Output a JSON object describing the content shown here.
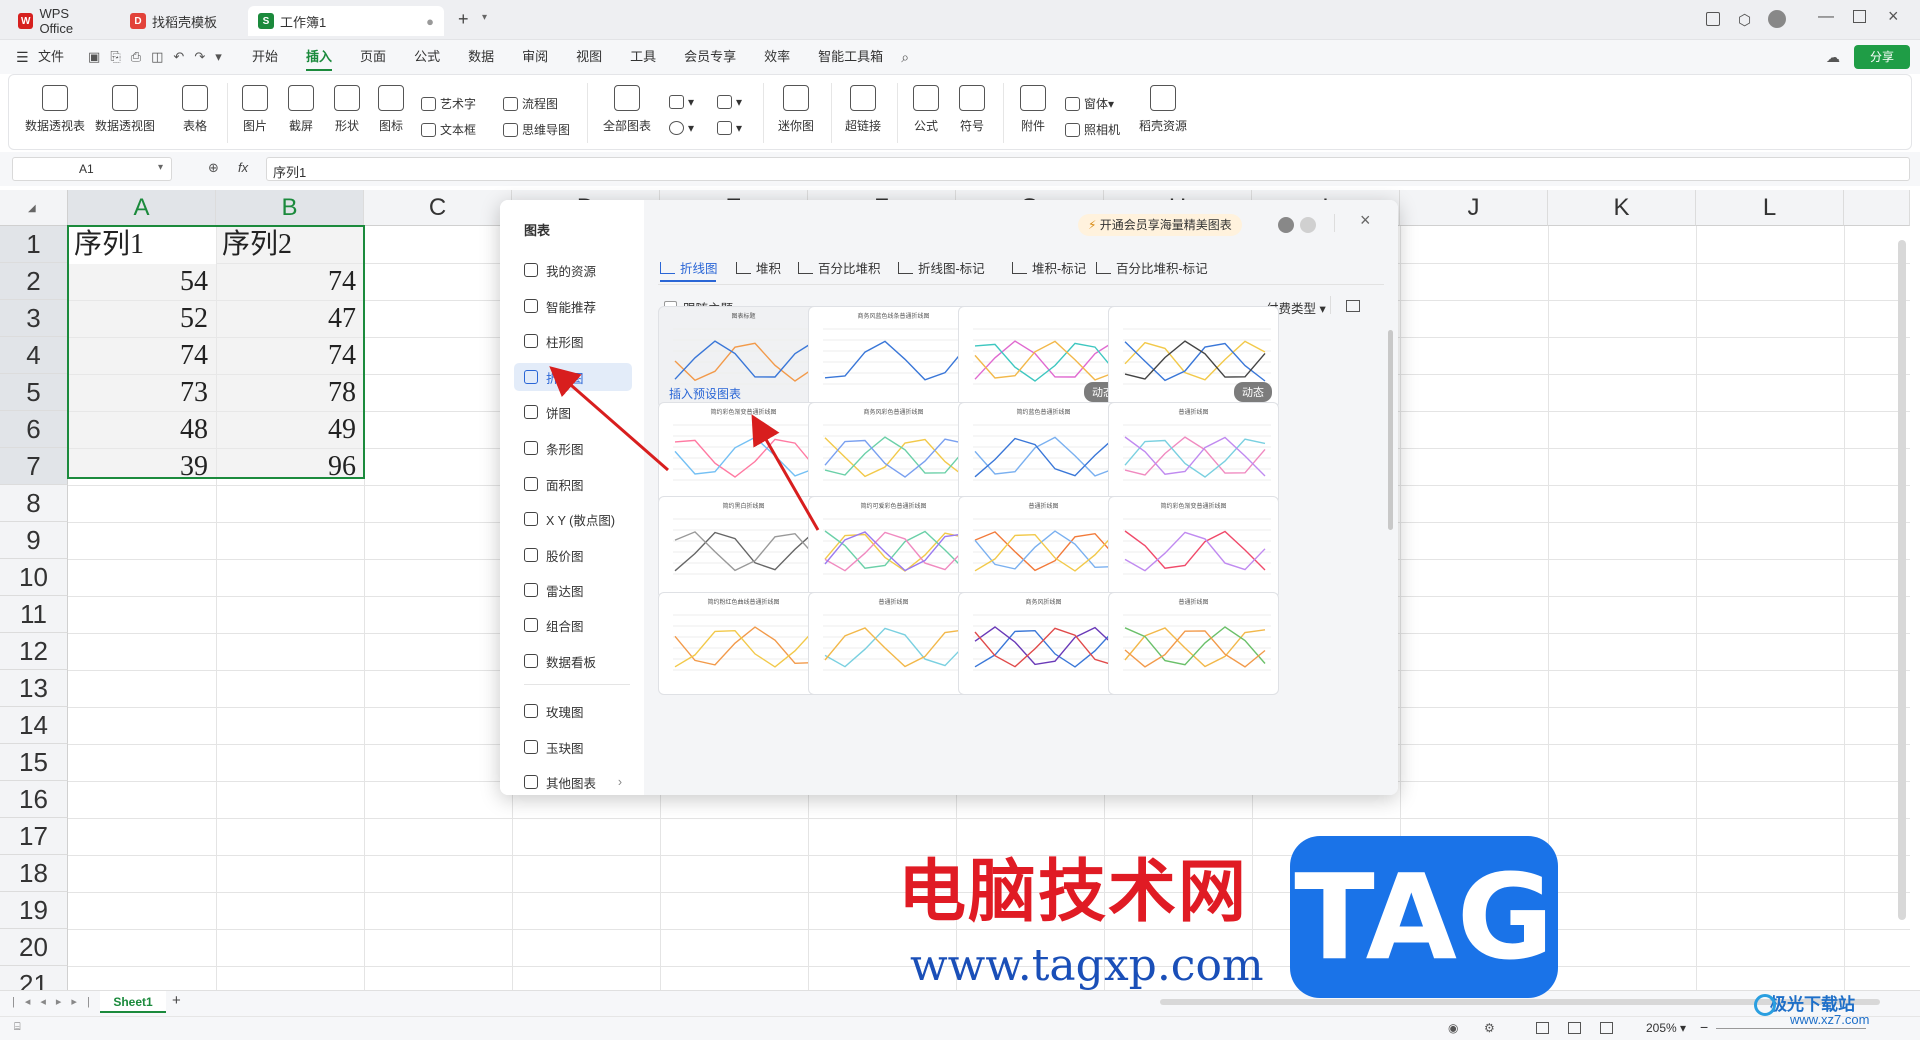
{
  "tabs": [
    {
      "label": "WPS Office"
    },
    {
      "label": "找稻壳模板"
    },
    {
      "label": "工作簿1"
    }
  ],
  "menu": {
    "file": "文件",
    "items": [
      "开始",
      "插入",
      "页面",
      "公式",
      "数据",
      "审阅",
      "视图",
      "工具",
      "会员专享",
      "效率",
      "智能工具箱"
    ],
    "share": "分享"
  },
  "ribbon": {
    "pivot_table": "数据透视表",
    "pivot_chart": "数据透视图",
    "table": "表格",
    "picture": "图片",
    "screenshot": "截屏",
    "shape": "形状",
    "icon": "图标",
    "wordart": "艺术字",
    "textbox": "文本框",
    "flowchart": "流程图",
    "mindmap": "思维导图",
    "all_charts": "全部图表",
    "sparkline": "迷你图",
    "hyperlink": "超链接",
    "formula": "公式",
    "symbol": "符号",
    "attachment": "附件",
    "camera": "照相机",
    "form": "窗体",
    "docer": "稻壳资源"
  },
  "formula_bar": {
    "cell_ref": "A1",
    "fx": "fx",
    "value": "序列1"
  },
  "columns": [
    "A",
    "B",
    "C",
    "D",
    "E",
    "F",
    "G",
    "H",
    "I",
    "J",
    "K",
    "L"
  ],
  "rows": [
    "1",
    "2",
    "3",
    "4",
    "5",
    "6",
    "7",
    "8",
    "9",
    "10",
    "11",
    "12",
    "13",
    "14",
    "15",
    "16",
    "17",
    "18",
    "19",
    "20",
    "21"
  ],
  "cells": {
    "header": [
      "序列1",
      "序列2"
    ],
    "seriesA": [
      "54",
      "52",
      "74",
      "73",
      "48",
      "39"
    ],
    "seriesB": [
      "74",
      "47",
      "74",
      "78",
      "49",
      "96"
    ]
  },
  "dialog": {
    "title": "图表",
    "promo": "开通会员享海量精美图表",
    "sidebar": [
      "我的资源",
      "智能推荐",
      "柱形图",
      "折线图",
      "饼图",
      "条形图",
      "面积图",
      "X Y (散点图)",
      "股价图",
      "雷达图",
      "组合图",
      "数据看板",
      "玫瑰图",
      "玉玦图",
      "其他图表"
    ],
    "subtabs": [
      "折线图",
      "堆积",
      "百分比堆积",
      "折线图-标记",
      "堆积-标记",
      "百分比堆积-标记"
    ],
    "follow_theme": "跟随主题",
    "pay_type": "付费类型",
    "insert_preset": "插入预设图表",
    "dynamic": "动态",
    "cards": [
      {
        "title": "图表标题"
      },
      {
        "title": "商务风蓝色线条普通折线图"
      },
      {
        "title": ""
      },
      {
        "title": ""
      },
      {
        "title": "简约彩色渐变普通折线图"
      },
      {
        "title": "商务风彩色普通折线图"
      },
      {
        "title": "简约蓝色普通折线图"
      },
      {
        "title": "普通折线图"
      },
      {
        "title": "简约黑白折线图"
      },
      {
        "title": "简约可爱彩色普通折线图"
      },
      {
        "title": "普通折线图"
      },
      {
        "title": "简约彩色渐变普通折线图"
      },
      {
        "title": "简约粉红色曲线普通折线图"
      },
      {
        "title": "普通折线图"
      },
      {
        "title": "商务风折线图"
      },
      {
        "title": "普通折线图"
      }
    ]
  },
  "sheet_tab": "Sheet1",
  "status": {
    "zoom": "205%"
  },
  "watermark": {
    "site_cn": "电脑技术网",
    "url": "www.tagxp.com",
    "tag": "TAG",
    "corner": "极光下载站",
    "corner_url": "www.xz7.com"
  },
  "colors": {
    "accent": "#1b8a3c",
    "dialog_blue": "#2a66d6",
    "arrow": "#d81e1e",
    "tag_blue": "#1a73e8",
    "wm_red": "#e01b24"
  }
}
